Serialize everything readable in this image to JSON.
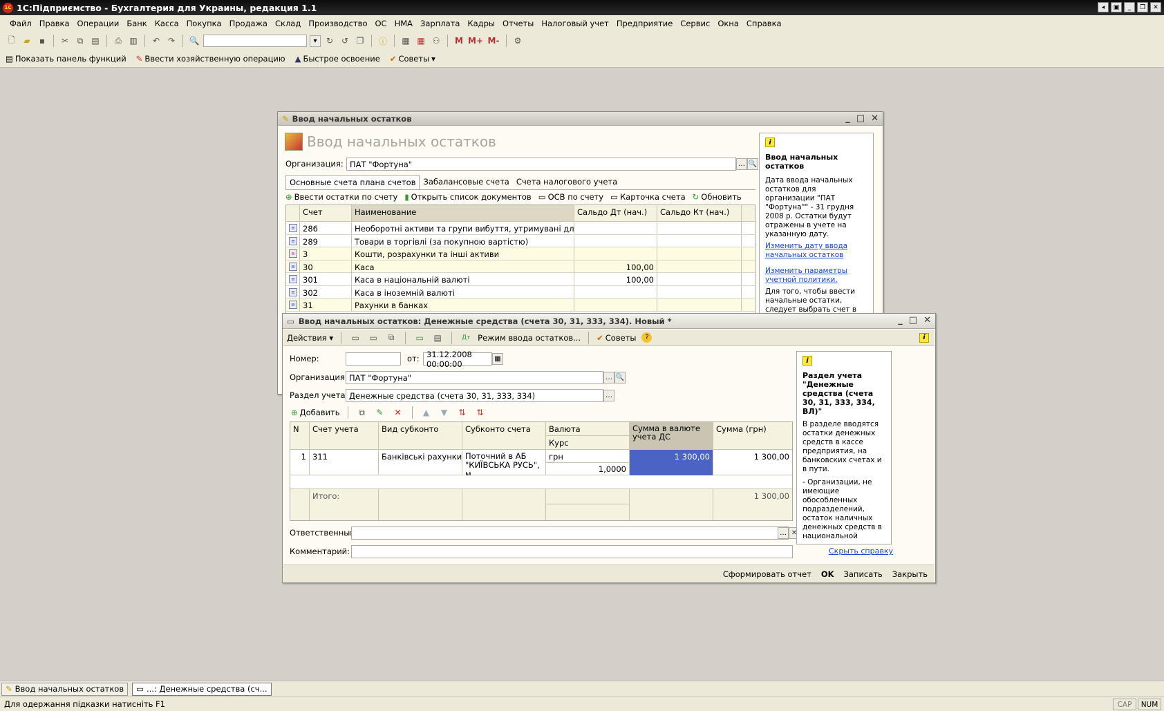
{
  "app": {
    "title": "1С:Підприємство - Бухгалтерия для Украины, редакция 1.1"
  },
  "menu": [
    "Файл",
    "Правка",
    "Операции",
    "Банк",
    "Касса",
    "Покупка",
    "Продажа",
    "Склад",
    "Производство",
    "ОС",
    "НМА",
    "Зарплата",
    "Кадры",
    "Отчеты",
    "Налоговый учет",
    "Предприятие",
    "Сервис",
    "Окна",
    "Справка"
  ],
  "toolbar2": {
    "show_panel": "Показать панель функций",
    "enter_op": "Ввести хозяйственную операцию",
    "quick": "Быстрое освоение",
    "tips": "Советы"
  },
  "toolbar1": {
    "memory": [
      "M",
      "M+",
      "M-"
    ]
  },
  "win1": {
    "title": "Ввод начальных остатков",
    "heading": "Ввод начальных остатков",
    "org_label": "Организация:",
    "org_value": "ПАТ \"Фортуна\"",
    "tabs": [
      "Основные счета плана счетов",
      "Забалансовые счета",
      "Счета налогового учета"
    ],
    "actions": [
      "Ввести остатки по счету",
      "Открыть список документов",
      "ОСВ по счету",
      "Карточка счета",
      "Обновить"
    ],
    "columns": [
      "Счет",
      "Наименование",
      "Сальдо Дт (нач.)",
      "Сальдо Кт (нач.)"
    ],
    "rows": [
      {
        "acc": "286",
        "name": "Необоротні активи та групи вибуття, утримувані для продажу",
        "dt": "",
        "kt": ""
      },
      {
        "acc": "289",
        "name": "Товари в торгівлі (за покупною вартістю)",
        "dt": "",
        "kt": ""
      },
      {
        "acc": "3",
        "name": "Кошти, розрахунки та інші активи",
        "dt": "",
        "kt": ""
      },
      {
        "acc": "30",
        "name": "Каса",
        "dt": "100,00",
        "kt": ""
      },
      {
        "acc": "301",
        "name": "Каса в національній валюті",
        "dt": "100,00",
        "kt": ""
      },
      {
        "acc": "302",
        "name": "Каса в іноземній валюті",
        "dt": "",
        "kt": ""
      },
      {
        "acc": "31",
        "name": "Рахунки в банках",
        "dt": "",
        "kt": ""
      }
    ],
    "help": {
      "title": "Ввод начальных остатков",
      "text": "Дата ввода начальных остатков для организации \"ПАТ \"Фортуна\"\" - 31 грудня 2008 р. Остатки будут отражены в учете на указанную дату.",
      "link1": "Изменить дату ввода начальных остатков",
      "link2": "Изменить параметры учетной политики.",
      "text2": "Для того, чтобы ввести начальные остатки, следует выбрать счет в"
    }
  },
  "win2": {
    "title": "Ввод начальных остатков: Денежные средства (счета 30, 31, 333, 334). Новый *",
    "actions_label": "Действия",
    "mode_label": "Режим ввода остатков...",
    "tips_label": "Советы",
    "number_label": "Номер:",
    "number_value": "",
    "from_label": "от:",
    "date_value": "31.12.2008 00:00:00",
    "org_label": "Организация:",
    "org_value": "ПАТ \"Фортуна\"",
    "section_label": "Раздел учета:",
    "section_value": "Денежные средства (счета 30, 31, 333, 334)",
    "add_label": "Добавить",
    "columns": {
      "n": "N",
      "acc": "Счет учета",
      "kind": "Вид субконто",
      "sub": "Субконто счета",
      "cur": "Валюта",
      "rate": "Курс",
      "sum_cur": "Сумма в валюте учета ДС",
      "sum": "Сумма (грн)"
    },
    "row": {
      "n": "1",
      "acc": "311",
      "kind": "Банківські рахунки",
      "sub": "Поточний в АБ \"КИЇВСЬКА РУСЬ\", м.",
      "cur": "грн",
      "rate": "1,0000",
      "sum_cur": "1 300,00",
      "sum": "1 300,00"
    },
    "total_label": "Итого:",
    "total_sum": "1 300,00",
    "resp_label": "Ответственный:",
    "comment_label": "Комментарий:",
    "help": {
      "title": "Раздел учета \"Денежные средства (счета 30, 31, 333, 334, ВЛ)\"",
      "text": "В разделе вводятся остатки денежных средств в кассе предприятия, на банковских счетах и в пути.",
      "text2": "- Организации, не имеющие обособленных подразделений, остаток наличных денежных средств в национальной",
      "hide": "Скрыть справку"
    },
    "footer": [
      "Сформировать отчет",
      "OK",
      "Записать",
      "Закрыть"
    ]
  },
  "taskbar": [
    "Ввод начальных остатков",
    "...: Денежные средства (сч..."
  ],
  "status": {
    "hint": "Для одержання підказки натисніть F1",
    "cap": "CAP",
    "num": "NUM"
  }
}
